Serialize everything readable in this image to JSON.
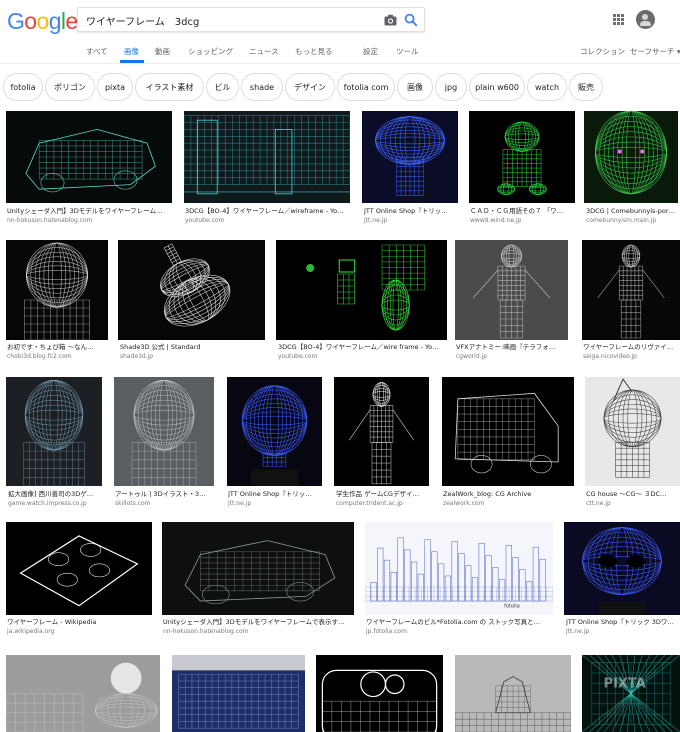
{
  "logo": {
    "letters": [
      "G",
      "o",
      "o",
      "g",
      "l",
      "e"
    ],
    "colors": [
      "#4285f4",
      "#ea4335",
      "#fbbc05",
      "#4285f4",
      "#34a853",
      "#ea4335"
    ]
  },
  "search": {
    "query": "ワイヤーフレーム　3dcg"
  },
  "tabs": [
    {
      "label": "すべて",
      "active": false
    },
    {
      "label": "画像",
      "active": true
    },
    {
      "label": "動画",
      "active": false
    },
    {
      "label": "ショッピング",
      "active": false
    },
    {
      "label": "ニュース",
      "active": false
    },
    {
      "label": "もっと見る",
      "active": false
    },
    {
      "label": "設定",
      "active": false
    },
    {
      "label": "ツール",
      "active": false
    },
    {
      "label": "コレクション",
      "active": false
    },
    {
      "label": "セーフサーチ ▾",
      "active": false
    }
  ],
  "chips": [
    "fotolia",
    "ポリゴン",
    "pixta",
    "イラスト素材",
    "ビル",
    "shade",
    "デザイン",
    "fotolia com",
    "画像",
    "jpg",
    "plain w600",
    "watch",
    "販売"
  ],
  "results": [
    {
      "title": "Unityシェーダ入門】3Dモデルをワイヤーフレーム…",
      "source": "nn-hokuson.hatenablog.com",
      "theme": "car",
      "bg": "#070a0a",
      "fg": "#5adbc2"
    },
    {
      "title": "3DCG【BO-4】ワイヤーフレーム／wireframe - Yo…",
      "source": "youtube.com",
      "theme": "city",
      "bg": "#0e1a1c",
      "fg": "#4bd5d9"
    },
    {
      "title": "JTT Online Shop『トリッ…",
      "source": "jtt.ne.jp",
      "theme": "mushroom",
      "bg": "#0a0c28",
      "fg": "#3f66ff"
    },
    {
      "title": "ＣＡＤ・ＣＧ用語その７ 「ワ…",
      "source": "www9.wind.ne.jp",
      "theme": "mario",
      "bg": "#000000",
      "fg": "#28d63f"
    },
    {
      "title": "3DCG | Comebunnyis-por…",
      "source": "comebunnyism.main.jp",
      "theme": "head",
      "bg": "#0a1a0a",
      "fg": "#38ca49"
    },
    {
      "title": "お初です・ちょび箱 〜なん…",
      "source": "chobi3d.blog.fc2.com",
      "theme": "girl",
      "bg": "#060606",
      "fg": "#d9d9d9"
    },
    {
      "title": "Shade3D 公式 | Standard",
      "source": "shade3d.jp",
      "theme": "violin",
      "bg": "#060606",
      "fg": "#e0e0e0"
    },
    {
      "title": "3DCG【BO-4】ワイヤーフレーム／wire frame - Yo…",
      "source": "youtube.com",
      "theme": "robot",
      "bg": "#000000",
      "fg": "#39e53f"
    },
    {
      "title": "VFXアナトミー:映画『テラフォ…",
      "source": "cgworld.jp",
      "theme": "monster",
      "bg": "#4b4b4b",
      "fg": "#c9c9c9"
    },
    {
      "title": "ワイヤーフレームのリヴァイ…",
      "source": "seiga.nicovideo.jp",
      "theme": "mermaid",
      "bg": "#070707",
      "fg": "#c4c4c4"
    },
    {
      "title": "拡大画像] 西川善司の3Dゲ…",
      "source": "game.watch.impress.co.jp",
      "theme": "schoolgirl",
      "bg": "#1c1f24",
      "fg": "#7aa0b5"
    },
    {
      "title": "アートゥル | 3Dイラスト・3…",
      "source": "skillots.com",
      "theme": "bust",
      "bg": "#5a5e63",
      "fg": "#c0c4c8"
    },
    {
      "title": "JTT Online Shop『トリッ…",
      "source": "jtt.ne.jp",
      "theme": "bulb",
      "bg": "#070711",
      "fg": "#3b5bff"
    },
    {
      "title": "学生作品 ゲームCGデザイ…",
      "source": "computer.trident.ac.jp",
      "theme": "warrior",
      "bg": "#000000",
      "fg": "#dddddd"
    },
    {
      "title": "ZealWork_blog: CG Archive",
      "source": "zealwork.com",
      "theme": "truck",
      "bg": "#000000",
      "fg": "#dcdcdc"
    },
    {
      "title": "CG house 〜CG〜 ３DC…",
      "source": "ctt.ne.jp",
      "theme": "cat",
      "bg": "#e8e8e8",
      "fg": "#3e3e3e"
    },
    {
      "title": "ワイヤーフレーム - Wikipedia",
      "source": "ja.wikipedia.org",
      "theme": "lego",
      "bg": "#000000",
      "fg": "#ffffff"
    },
    {
      "title": "Unityシェーダ入門】3Dモデルをワイヤーフレームで表示す…",
      "source": "nn-hokuson.hatenablog.com",
      "theme": "car2",
      "bg": "#0d0f10",
      "fg": "#8f9c97"
    },
    {
      "title": "ワイヤーフレームのビル*Fotolia.com の ストック写真と…",
      "source": "jp.fotolia.com",
      "theme": "skyline",
      "bg": "#f4f6fb",
      "fg": "#4a5fc2"
    },
    {
      "title": "JTT Online Shop『トリック 3Dワ…",
      "source": "jtt.ne.jp",
      "theme": "skull",
      "bg": "#0a0a22",
      "fg": "#3d5cff"
    },
    {
      "title": "",
      "source": "",
      "theme": "toys",
      "bg": "#9c9c9c",
      "fg": "#d0d0d0"
    },
    {
      "title": "",
      "source": "",
      "theme": "room",
      "bg": "#1e2e66",
      "fg": "#8fa5e8"
    },
    {
      "title": "",
      "source": "",
      "theme": "phone",
      "bg": "#000000",
      "fg": "#ffffff"
    },
    {
      "title": "",
      "source": "",
      "theme": "castle",
      "bg": "#b9b9b9",
      "fg": "#3a3a3a"
    },
    {
      "title": "",
      "source": "",
      "theme": "grid",
      "bg": "#03110f",
      "fg": "#2fd7c0"
    }
  ],
  "watermark": "PIXTA"
}
